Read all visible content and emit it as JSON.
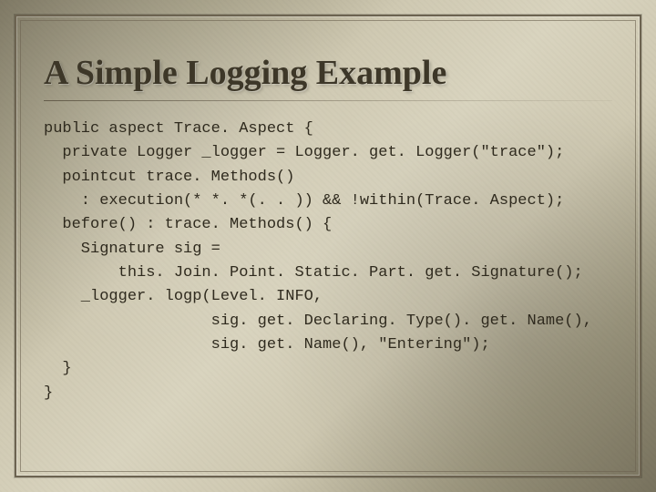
{
  "title": "A Simple Logging Example",
  "code_lines": [
    "public aspect Trace. Aspect {",
    "  private Logger _logger = Logger. get. Logger(\"trace\");",
    "  pointcut trace. Methods()",
    "    : execution(* *. *(. . )) && !within(Trace. Aspect);",
    "  before() : trace. Methods() {",
    "    Signature sig =",
    "        this. Join. Point. Static. Part. get. Signature();",
    "    _logger. logp(Level. INFO,",
    "                  sig. get. Declaring. Type(). get. Name(),",
    "                  sig. get. Name(), \"Entering\");",
    "  }",
    "}"
  ]
}
